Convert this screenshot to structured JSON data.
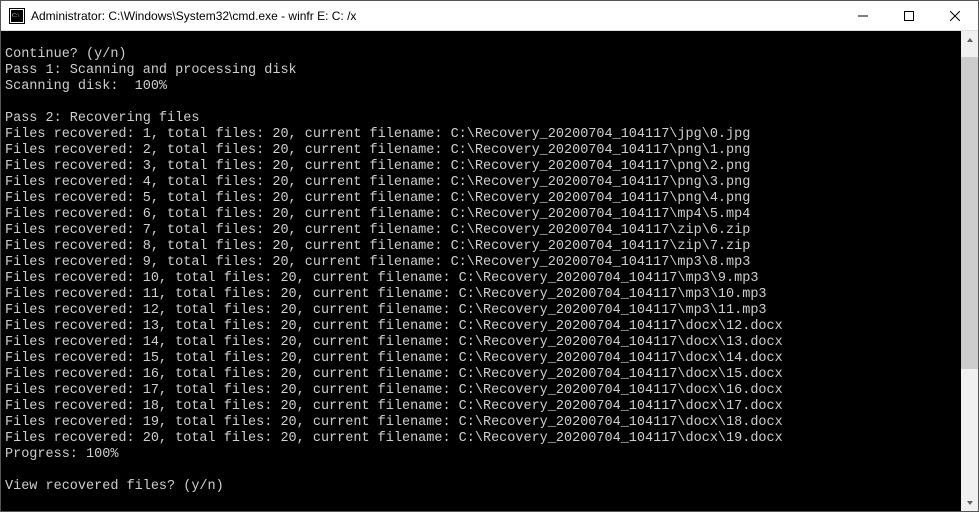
{
  "titlebar": {
    "title": "Administrator: C:\\Windows\\System32\\cmd.exe - winfr  E: C: /x"
  },
  "terminal": {
    "prompt_continue": "Continue? (y/n)",
    "pass1_header": "Pass 1: Scanning and processing disk",
    "scanning_line": "Scanning disk:  100%",
    "pass2_header": "Pass 2: Recovering files",
    "rows": [
      "Files recovered: 1, total files: 20, current filename: C:\\Recovery_20200704_104117\\jpg\\0.jpg",
      "Files recovered: 2, total files: 20, current filename: C:\\Recovery_20200704_104117\\png\\1.png",
      "Files recovered: 3, total files: 20, current filename: C:\\Recovery_20200704_104117\\png\\2.png",
      "Files recovered: 4, total files: 20, current filename: C:\\Recovery_20200704_104117\\png\\3.png",
      "Files recovered: 5, total files: 20, current filename: C:\\Recovery_20200704_104117\\png\\4.png",
      "Files recovered: 6, total files: 20, current filename: C:\\Recovery_20200704_104117\\mp4\\5.mp4",
      "Files recovered: 7, total files: 20, current filename: C:\\Recovery_20200704_104117\\zip\\6.zip",
      "Files recovered: 8, total files: 20, current filename: C:\\Recovery_20200704_104117\\zip\\7.zip",
      "Files recovered: 9, total files: 20, current filename: C:\\Recovery_20200704_104117\\mp3\\8.mp3",
      "Files recovered: 10, total files: 20, current filename: C:\\Recovery_20200704_104117\\mp3\\9.mp3",
      "Files recovered: 11, total files: 20, current filename: C:\\Recovery_20200704_104117\\mp3\\10.mp3",
      "Files recovered: 12, total files: 20, current filename: C:\\Recovery_20200704_104117\\mp3\\11.mp3",
      "Files recovered: 13, total files: 20, current filename: C:\\Recovery_20200704_104117\\docx\\12.docx",
      "Files recovered: 14, total files: 20, current filename: C:\\Recovery_20200704_104117\\docx\\13.docx",
      "Files recovered: 15, total files: 20, current filename: C:\\Recovery_20200704_104117\\docx\\14.docx",
      "Files recovered: 16, total files: 20, current filename: C:\\Recovery_20200704_104117\\docx\\15.docx",
      "Files recovered: 17, total files: 20, current filename: C:\\Recovery_20200704_104117\\docx\\16.docx",
      "Files recovered: 18, total files: 20, current filename: C:\\Recovery_20200704_104117\\docx\\17.docx",
      "Files recovered: 19, total files: 20, current filename: C:\\Recovery_20200704_104117\\docx\\18.docx",
      "Files recovered: 20, total files: 20, current filename: C:\\Recovery_20200704_104117\\docx\\19.docx"
    ],
    "progress_line": "Progress: 100%",
    "prompt_view": "View recovered files? (y/n)"
  },
  "scrollbar": {
    "thumb_top_pct": 2,
    "thumb_height_pct": 70
  }
}
